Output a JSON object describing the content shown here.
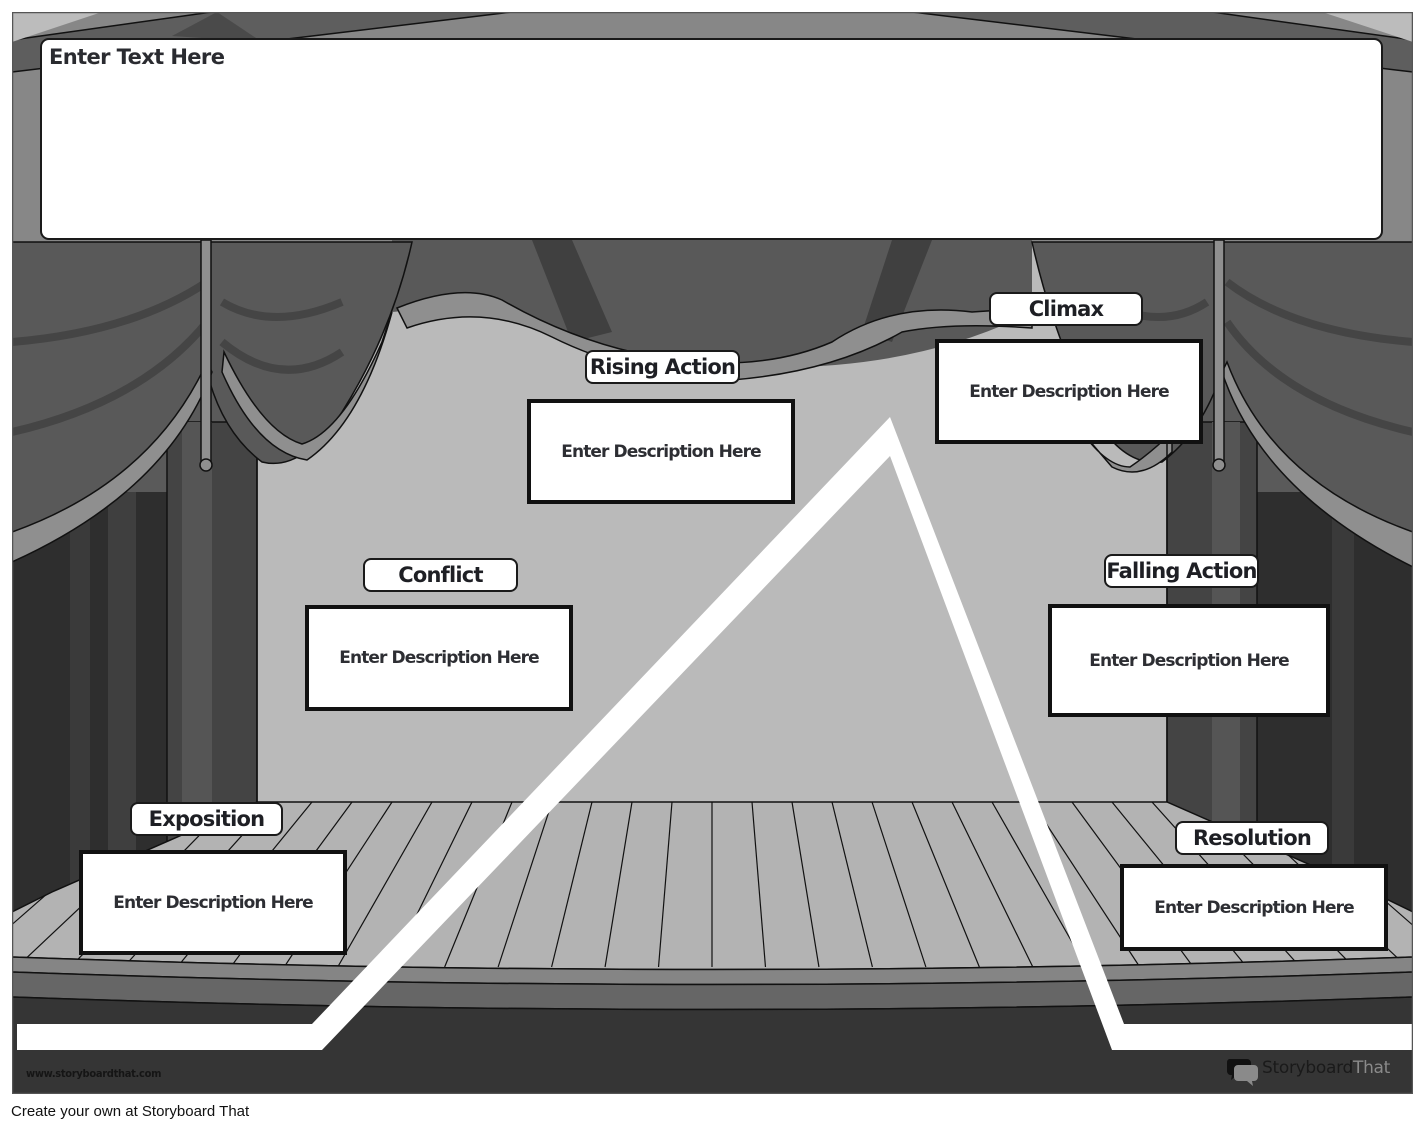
{
  "title_box": {
    "placeholder": "Enter Text Here"
  },
  "plot_stages": [
    {
      "key": "exposition",
      "label": "Exposition",
      "description": "Enter Description Here"
    },
    {
      "key": "conflict",
      "label": "Conflict",
      "description": "Enter Description Here"
    },
    {
      "key": "rising_action",
      "label": "Rising Action",
      "description": "Enter Description Here"
    },
    {
      "key": "climax",
      "label": "Climax",
      "description": "Enter Description Here"
    },
    {
      "key": "falling_action",
      "label": "Falling Action",
      "description": "Enter Description Here"
    },
    {
      "key": "resolution",
      "label": "Resolution",
      "description": "Enter Description Here"
    }
  ],
  "footer": {
    "watermark_url": "www.storyboardthat.com",
    "brand_part1": "Storyboard",
    "brand_part2": "That",
    "brand_icon": "speech-bubbles-icon"
  },
  "caption": "Create your own at Storyboard That",
  "colors": {
    "backdrop": "#bababa",
    "curtain_dark": "#3f3f3f",
    "curtain_mid": "#595959",
    "curtain_trim": "#8f8f8f",
    "floor": "#b3b3b3",
    "stage_base": "#353535",
    "plot_line": "#ffffff"
  }
}
